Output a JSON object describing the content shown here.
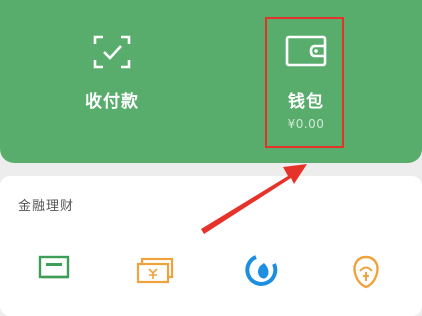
{
  "top_panel": {
    "pay_label": "收付款",
    "wallet_label": "钱包",
    "wallet_balance": "¥0.00"
  },
  "finance": {
    "title": "金融理财"
  },
  "colors": {
    "panel_green": "#58ad6d",
    "highlight_red": "#e6332a",
    "icon_green": "#3e9e59",
    "icon_orange": "#f0a23c",
    "icon_blue": "#1d8fe0"
  },
  "icons": {
    "pay": "scan-check-icon",
    "wallet": "wallet-icon",
    "finance_items": [
      "card-icon",
      "cash-icon",
      "fund-icon",
      "piggy-icon"
    ]
  }
}
